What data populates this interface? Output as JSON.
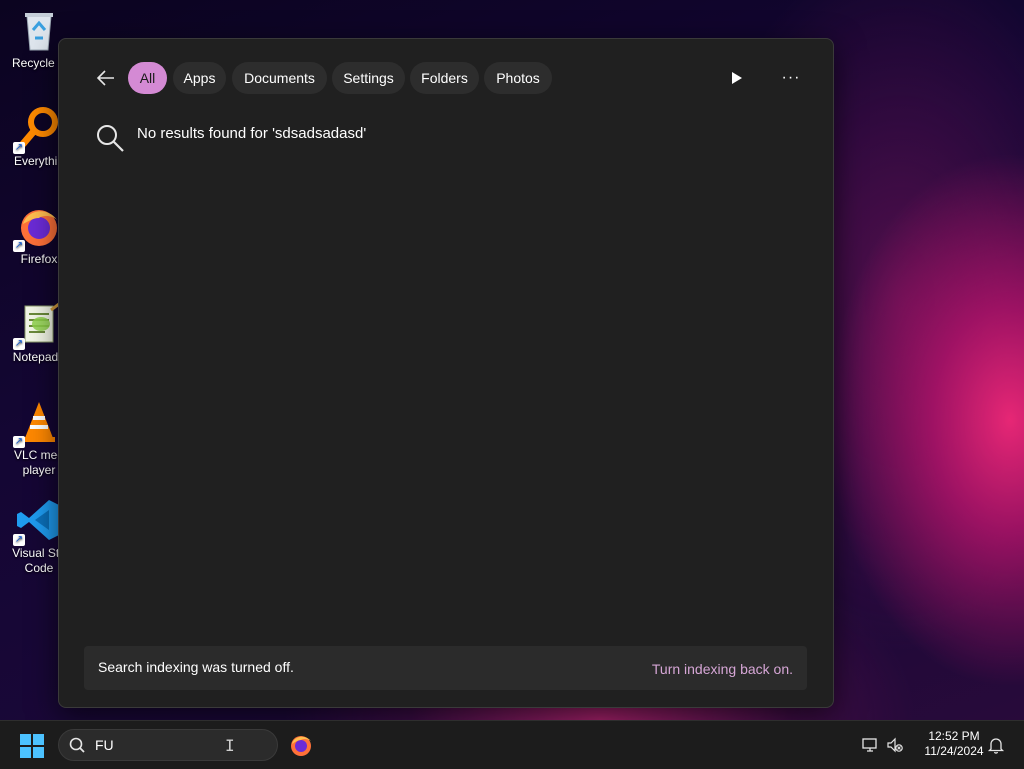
{
  "desktop": {
    "icons": [
      {
        "label": "Recycle B",
        "icon": "recycle-bin-icon"
      },
      {
        "label": "Everythin",
        "icon": "everything-search-icon"
      },
      {
        "label": "Firefox",
        "icon": "firefox-icon"
      },
      {
        "label": "Notepad+",
        "icon": "notepad-plus-plus-icon"
      },
      {
        "label": "VLC med\nplayer",
        "icon": "vlc-icon"
      },
      {
        "label": "Visual Stu\nCode",
        "icon": "vscode-icon"
      }
    ]
  },
  "search_panel": {
    "filters": [
      "All",
      "Apps",
      "Documents",
      "Settings",
      "Folders",
      "Photos"
    ],
    "active_filter": "All",
    "no_results_text": "No results found for 'sdsadsadasd'",
    "indexing": {
      "message": "Search indexing was turned off.",
      "link": "Turn indexing back on."
    }
  },
  "taskbar": {
    "search_value": "FU",
    "time": "12:52 PM",
    "date": "11/24/2024"
  },
  "colors": {
    "accent_pill": "#d48ad4",
    "panel_bg": "#202020",
    "start_blue": "#4cc2ff"
  }
}
